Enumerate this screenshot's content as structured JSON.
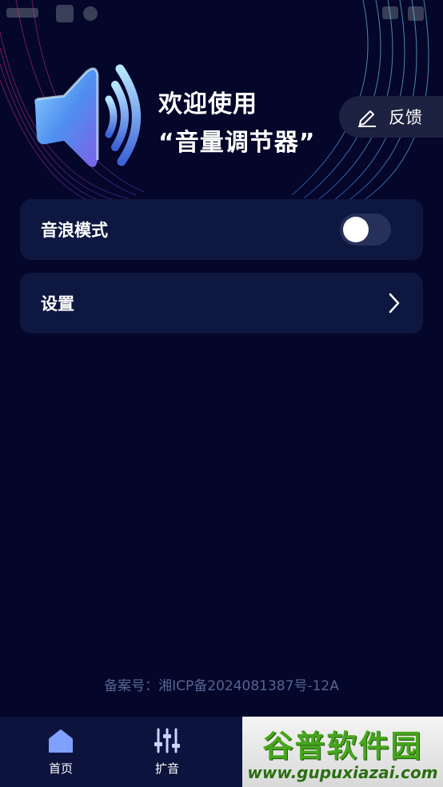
{
  "hero": {
    "welcome_line1": "欢迎使用",
    "welcome_line2": "“音量调节器”",
    "feedback_label": "反馈",
    "speaker_icon": "speaker-volume-icon"
  },
  "cards": {
    "wave_mode_label": "音浪模式",
    "wave_mode_enabled": false,
    "settings_label": "设置"
  },
  "footer": {
    "icp": "备案号：湘ICP备2024081387号-12A"
  },
  "nav": {
    "home_label": "首页",
    "amplify_label": "扩音"
  },
  "watermark": {
    "title": "谷普软件园",
    "url": "www.gupuxiazai.com"
  },
  "colors": {
    "background": "#04062a",
    "card": "#0e1740",
    "accent_blue": "#5a9df0",
    "nav_active": "#7fa0ff",
    "icp_text": "#566591"
  }
}
